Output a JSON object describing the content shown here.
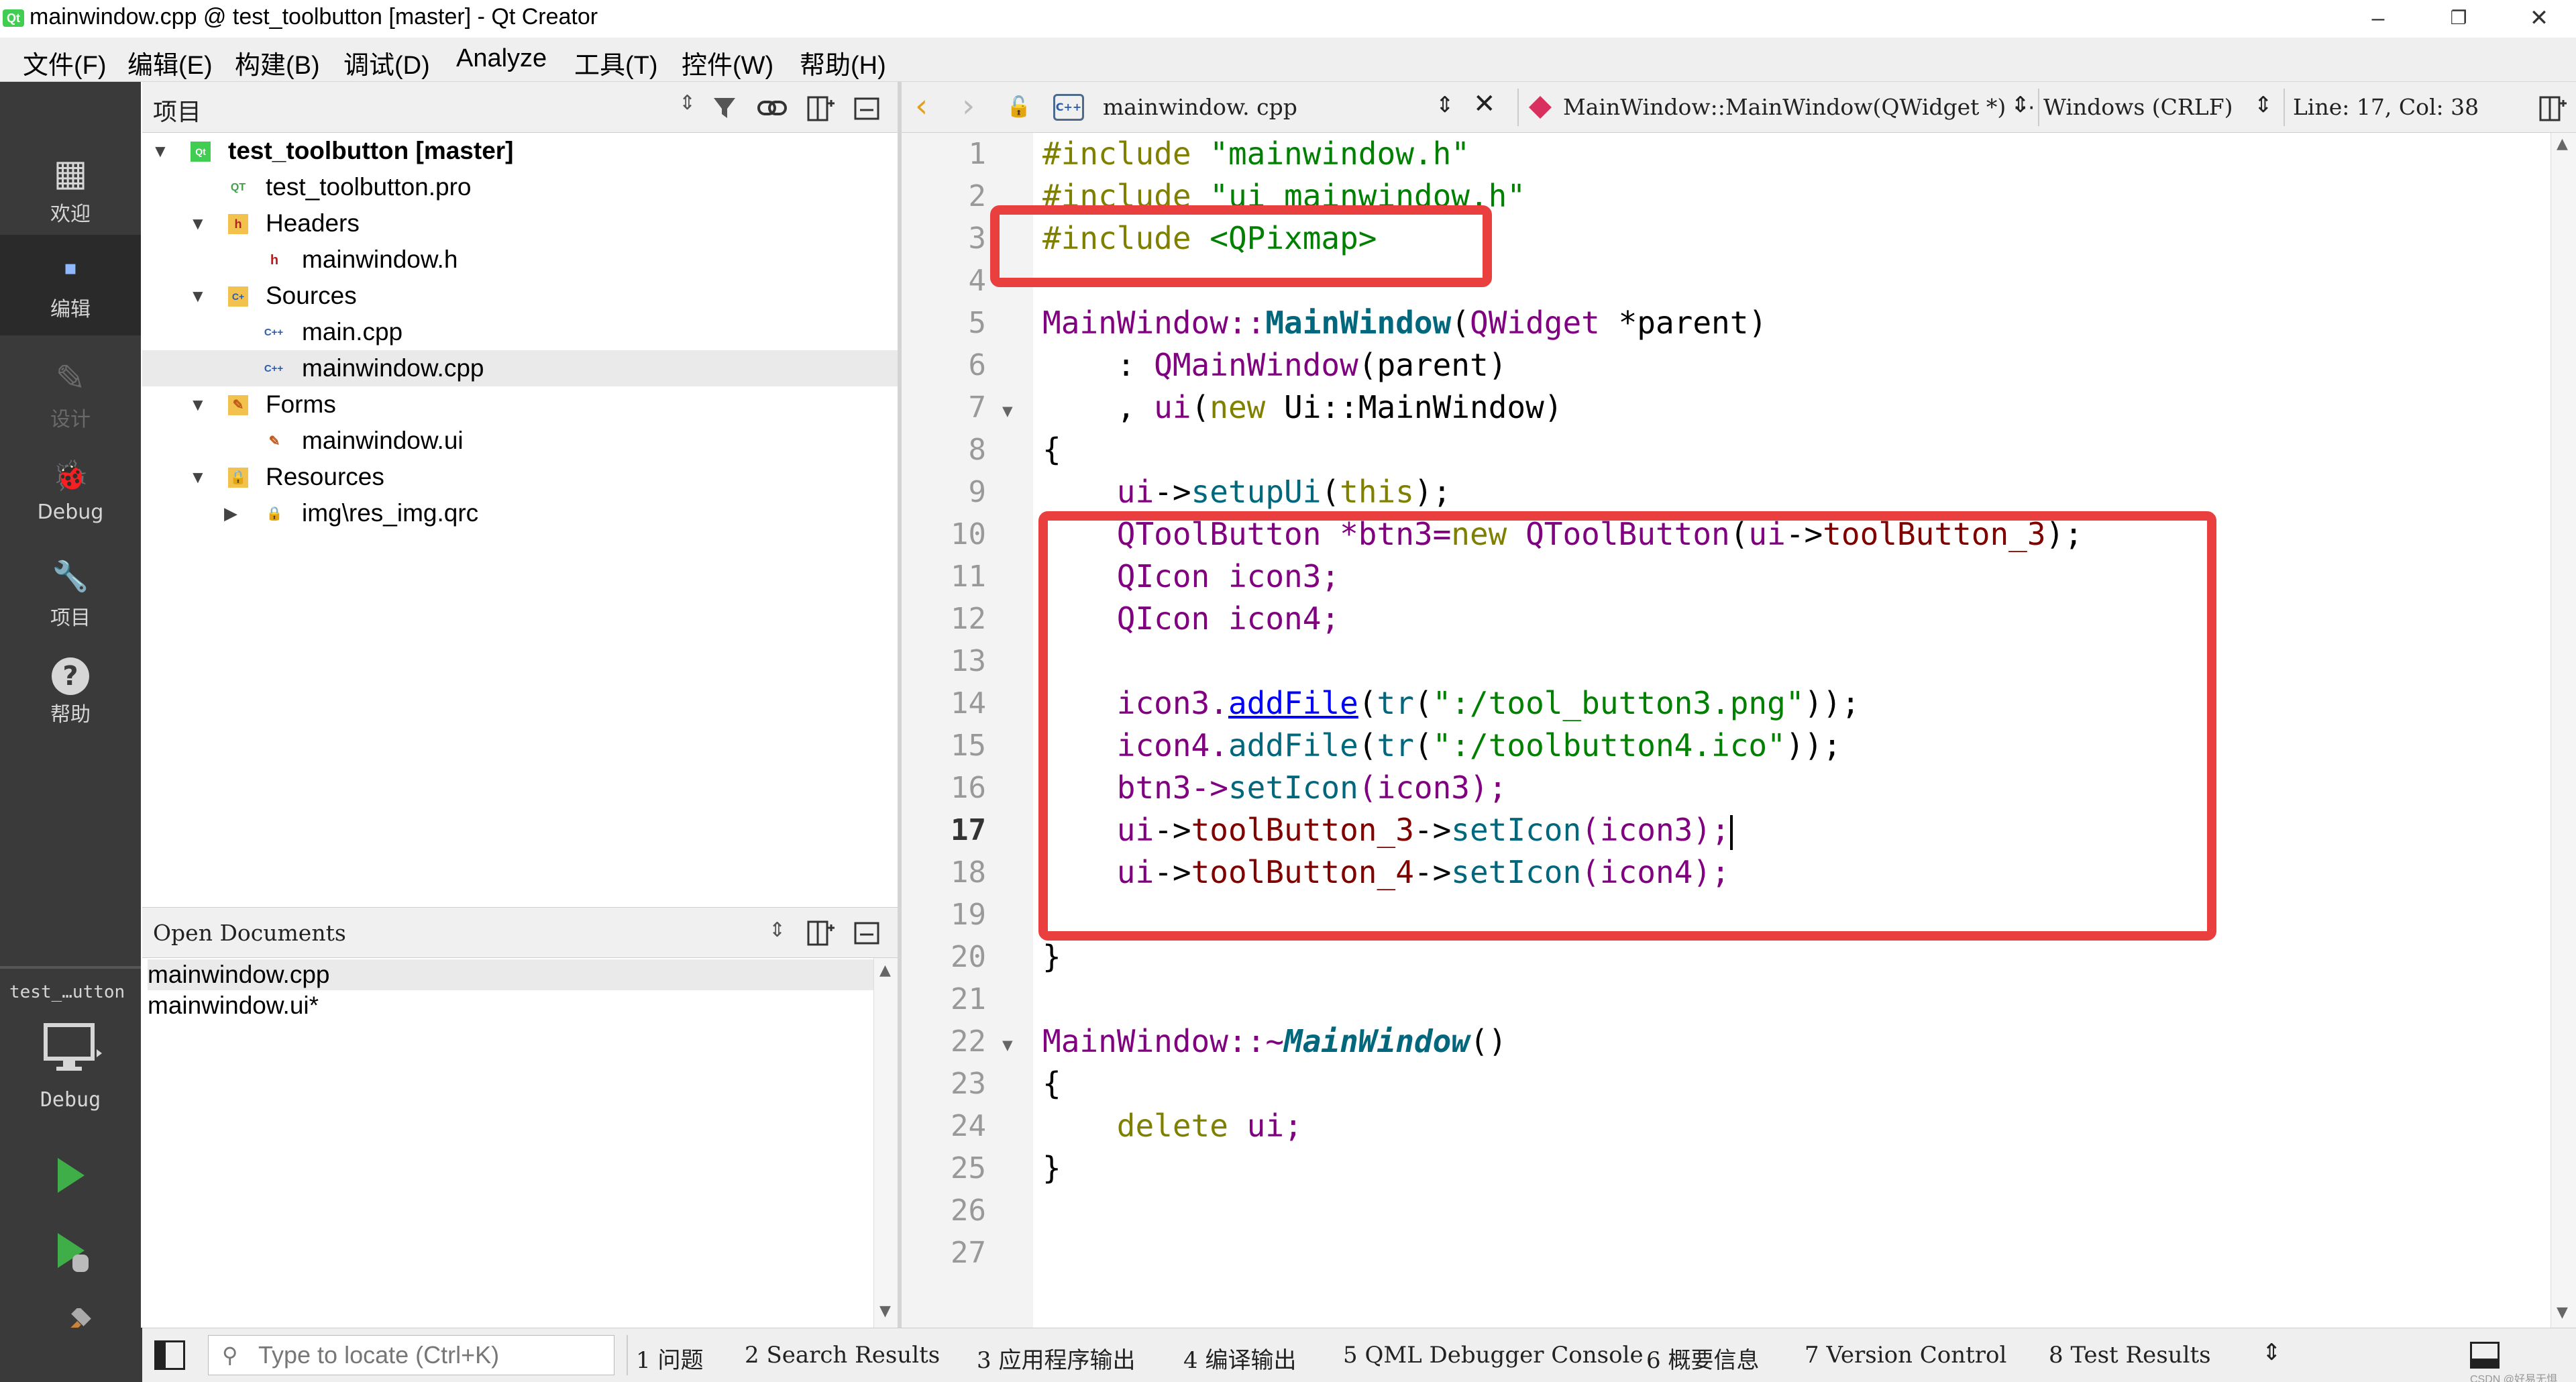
{
  "window": {
    "title": "mainwindow.cpp @ test_toolbutton [master] - Qt Creator",
    "logo_text": "Qt",
    "minimize": "–",
    "restore": "❐",
    "close": "✕"
  },
  "menu": [
    "文件(F)",
    "编辑(E)",
    "构建(B)",
    "调试(D)",
    "Analyze",
    "工具(T)",
    "控件(W)",
    "帮助(H)"
  ],
  "modes": [
    {
      "label": "欢迎",
      "icon": "grid-icon",
      "glyph": "▦"
    },
    {
      "label": "编辑",
      "icon": "edit-mode-icon",
      "glyph": "▪"
    },
    {
      "label": "设计",
      "icon": "design-pencil-icon",
      "glyph": "✎"
    },
    {
      "label": "Debug",
      "icon": "bug-icon",
      "glyph": "🐞"
    },
    {
      "label": "项目",
      "icon": "wrench-icon",
      "glyph": "🔧"
    },
    {
      "label": "帮助",
      "icon": "help-icon",
      "glyph": "?"
    }
  ],
  "kit": {
    "project": "test_…utton",
    "label": "Debug"
  },
  "project_panel": {
    "title": "项目",
    "tree": [
      {
        "label": "test_toolbutton [master]",
        "icon": "qt-project-icon"
      },
      {
        "label": "test_toolbutton.pro",
        "icon": "pro-file-icon"
      },
      {
        "label": "Headers",
        "icon": "headers-folder-icon"
      },
      {
        "label": "mainwindow.h",
        "icon": "header-file-icon"
      },
      {
        "label": "Sources",
        "icon": "sources-folder-icon"
      },
      {
        "label": "main.cpp",
        "icon": "cpp-file-icon"
      },
      {
        "label": "mainwindow.cpp",
        "icon": "cpp-file-icon"
      },
      {
        "label": "Forms",
        "icon": "forms-folder-icon"
      },
      {
        "label": "mainwindow.ui",
        "icon": "ui-file-icon"
      },
      {
        "label": "Resources",
        "icon": "resources-folder-icon"
      },
      {
        "label": "img\\res_img.qrc",
        "icon": "qrc-file-icon"
      }
    ],
    "selected_index": 6
  },
  "open_documents": {
    "title": "Open Documents",
    "items": [
      "mainwindow.cpp",
      "mainwindow.ui*"
    ]
  },
  "editor_toolbar": {
    "file_name": "mainwindow. cpp",
    "file_badge": "C++",
    "symbol": "MainWindow::MainWindow(QWidget *) ⋯",
    "line_endings": "Windows (CRLF)",
    "position": "Line: 17, Col: 38"
  },
  "editor": {
    "current_line": 17,
    "line_numbers": [
      "1",
      "2",
      "3",
      "4",
      "5",
      "6",
      "7",
      "8",
      "9",
      "10",
      "11",
      "12",
      "13",
      "14",
      "15",
      "16",
      "17",
      "18",
      "19",
      "20",
      "21",
      "22",
      "23",
      "24",
      "25",
      "26",
      "27"
    ],
    "code": {
      "l1_kw": "#include ",
      "l1_str": "\"mainwindow.h\"",
      "l2_kw": "#include ",
      "l2_str": "\"ui_mainwindow.h\"",
      "l3_kw": "#include ",
      "l3_str": "<QPixmap>",
      "l5_a": "MainWindow::",
      "l5_b": "MainWindow",
      "l5_c": "(",
      "l5_d": "QWidget",
      "l5_e": " *parent)",
      "l6_a": "    : ",
      "l6_b": "QMainWindow",
      "l6_c": "(parent)",
      "l7_a": "    , ",
      "l7_b": "ui",
      "l7_c": "(",
      "l7_d": "new",
      "l7_e": " Ui::MainWindow)",
      "l8": "{",
      "l9_a": "    ",
      "l9_b": "ui",
      "l9_c": "->",
      "l9_d": "setupUi",
      "l9_e": "(",
      "l9_f": "this",
      "l9_g": ");",
      "l10_a": "    QToolButton *btn3=",
      "l10_b": "new",
      "l10_c": " QToolButton",
      "l10_d": "(",
      "l10_e": "ui",
      "l10_f": "->",
      "l10_g": "toolButton_3",
      "l10_h": ");",
      "l11": "    QIcon icon3;",
      "l12": "    QIcon icon4;",
      "l14_a": "    icon3.",
      "l14_b": "addFile",
      "l14_c": "(",
      "l14_d": "tr",
      "l14_e": "(",
      "l14_f": "\":/tool_button3.png\"",
      "l14_g": "));",
      "l15_a": "    icon4.",
      "l15_b": "addFile",
      "l15_c": "(",
      "l15_d": "tr",
      "l15_e": "(",
      "l15_f": "\":/toolbutton4.ico\"",
      "l15_g": "));",
      "l16_a": "    btn3->",
      "l16_b": "setIcon",
      "l16_c": "(icon3);",
      "l17_a": "    ",
      "l17_b": "ui",
      "l17_c": "->",
      "l17_d": "toolButton_3",
      "l17_e": "->",
      "l17_f": "setIcon",
      "l17_g": "(icon3);",
      "l18_a": "    ",
      "l18_b": "ui",
      "l18_c": "->",
      "l18_d": "toolButton_4",
      "l18_e": "->",
      "l18_f": "setIcon",
      "l18_g": "(icon4);",
      "l20": "}",
      "l22_a": "MainWindow::~",
      "l22_b": "MainWindow",
      "l22_c": "()",
      "l23": "{",
      "l24_a": "    ",
      "l24_b": "delete",
      "l24_c": " ui;",
      "l25": "}"
    }
  },
  "status_bar": {
    "locator_placeholder": "Type to locate (Ctrl+K)",
    "tabs": [
      "1 问题",
      "2 Search Results",
      "3 应用程序输出",
      "4 编译输出",
      "5 QML Debugger Console",
      "6 概要信息",
      "7 Version Control",
      "8 Test Results"
    ],
    "watermark": "CSDN @好易无惧"
  }
}
